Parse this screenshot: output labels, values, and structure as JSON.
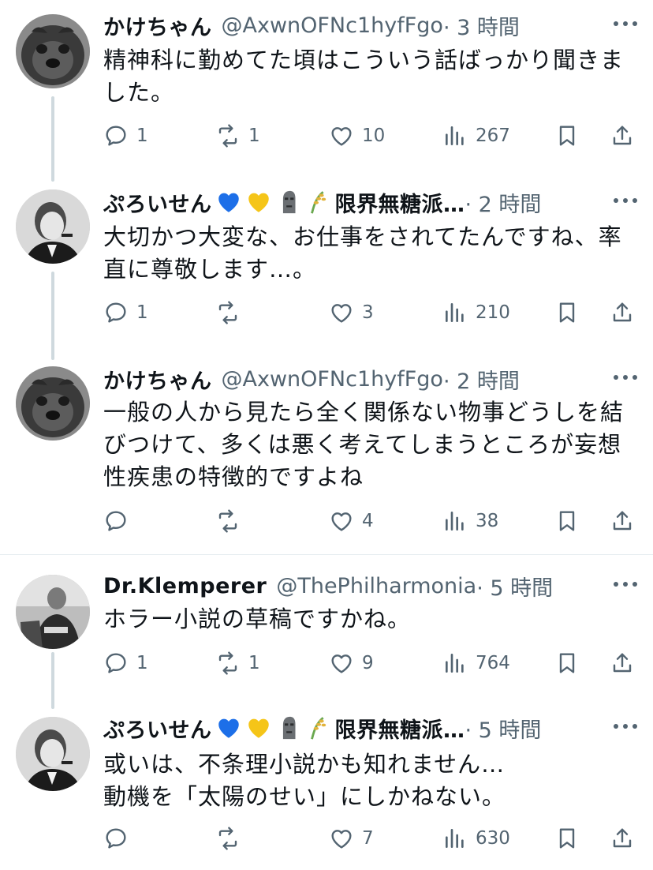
{
  "colors": {
    "text": "#0f1419",
    "secondary": "#536471",
    "divider": "#e6ecf0",
    "thread_line": "#cfd9de"
  },
  "tweets": [
    {
      "name": "かけちゃん",
      "handle": "@AxwnOFNc1hyfFgo",
      "time": "· 3 時間",
      "avatar": "pug-avatar",
      "badges": [],
      "text": "精神科に勤めてた頃はこういう話ばっかり聞きま\nした。",
      "replies": "1",
      "retweets": "1",
      "likes": "10",
      "views": "267"
    },
    {
      "name": "ぷろいせん",
      "handle": "",
      "time": "· 2 時間",
      "avatar": "man-pipe-avatar",
      "badges": [
        "blue-heart-icon",
        "yellow-heart-icon",
        "moai-icon",
        "rice-icon"
      ],
      "subtitle": "限界無糖派…",
      "text": "大切かつ大変な、お仕事をされてたんですね、率\n直に尊敬します…。",
      "replies": "1",
      "retweets": "",
      "likes": "3",
      "views": "210"
    },
    {
      "name": "かけちゃん",
      "handle": "@AxwnOFNc1hyfFgo",
      "time": "· 2 時間",
      "avatar": "pug-avatar",
      "badges": [],
      "text": "一般の人から見たら全く関係ない物事どうしを結\nびつけて、多くは悪く考えてしまうところが妄想\n性疾患の特徴的ですよね",
      "replies": "",
      "retweets": "",
      "likes": "4",
      "views": "38"
    },
    {
      "name": "Dr.Klemperer",
      "handle": "@ThePhilharmonia",
      "time": "· 5 時間",
      "avatar": "conductor-avatar",
      "badges": [],
      "text": "ホラー小説の草稿ですかね。",
      "replies": "1",
      "retweets": "1",
      "likes": "9",
      "views": "764"
    },
    {
      "name": "ぷろいせん",
      "handle": "",
      "time": "· 5 時間",
      "avatar": "man-pipe-avatar",
      "badges": [
        "blue-heart-icon",
        "yellow-heart-icon",
        "moai-icon",
        "rice-icon"
      ],
      "subtitle": "限界無糖派…",
      "text": "或いは、不条理小説かも知れません…\n動機を「太陽のせい」にしかねない。",
      "replies": "",
      "retweets": "",
      "likes": "7",
      "views": "630"
    }
  ]
}
